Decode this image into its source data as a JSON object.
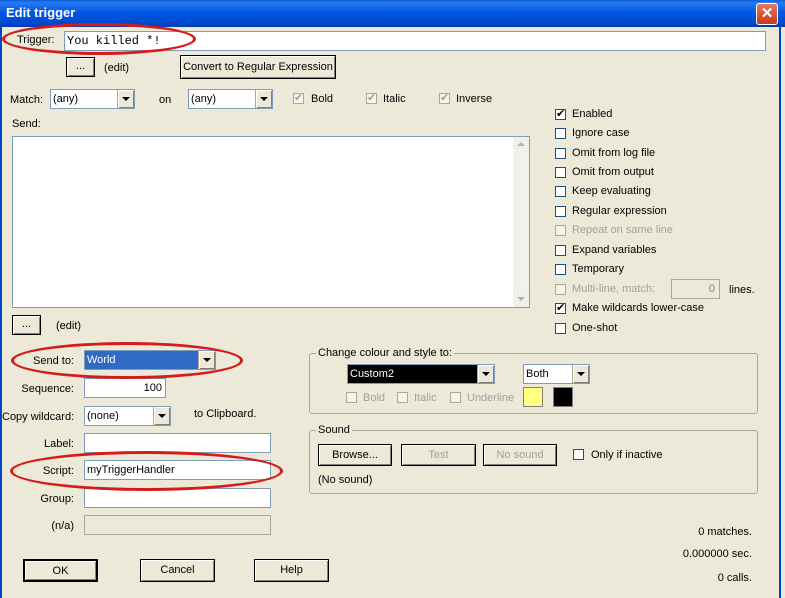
{
  "window": {
    "title": "Edit trigger",
    "close_glyph": "✕"
  },
  "trigger": {
    "label": "Trigger:",
    "value": "You killed *!",
    "edit_btn": "...",
    "edit_label": "(edit)",
    "convert_btn": "Convert to Regular Expression"
  },
  "match": {
    "label": "Match:",
    "fg_value": "(any)",
    "on_label": "on",
    "bg_value": "(any)",
    "bold": {
      "label": "Bold",
      "checked": true
    },
    "italic": {
      "label": "Italic",
      "checked": true
    },
    "inverse": {
      "label": "Inverse",
      "checked": true
    }
  },
  "send": {
    "label": "Send:",
    "value": "",
    "edit_btn": "...",
    "edit_label": "(edit)"
  },
  "options": [
    {
      "label": "Enabled",
      "checked": true,
      "enabled": true
    },
    {
      "label": "Ignore case",
      "checked": false,
      "enabled": true
    },
    {
      "label": "Omit from log file",
      "checked": false,
      "enabled": true
    },
    {
      "label": "Omit from output",
      "checked": false,
      "enabled": true
    },
    {
      "label": "Keep evaluating",
      "checked": false,
      "enabled": true
    },
    {
      "label": "Regular expression",
      "checked": false,
      "enabled": true
    },
    {
      "label": "Repeat on same line",
      "checked": false,
      "enabled": false
    },
    {
      "label": "Expand variables",
      "checked": false,
      "enabled": true
    },
    {
      "label": "Temporary",
      "checked": false,
      "enabled": true
    },
    {
      "label": "Multi-line, match:",
      "checked": false,
      "enabled": false
    },
    {
      "label": "Make wildcards lower-case",
      "checked": true,
      "enabled": true
    },
    {
      "label": "One-shot",
      "checked": false,
      "enabled": true
    }
  ],
  "multiline": {
    "lines_value": "0",
    "lines_label": "lines."
  },
  "send_to": {
    "label": "Send to:",
    "value": "World"
  },
  "sequence": {
    "label": "Sequence:",
    "value": "100"
  },
  "copy_wildcard": {
    "label": "Copy wildcard:",
    "value": "(none)",
    "suffix": "to Clipboard."
  },
  "label_field": {
    "label": "Label:",
    "value": ""
  },
  "script": {
    "label": "Script:",
    "value": "myTriggerHandler"
  },
  "group": {
    "label": "Group:",
    "value": ""
  },
  "na": {
    "label": "(n/a)",
    "value": ""
  },
  "colour": {
    "group_title": "Change colour and style to:",
    "colour_value": "Custom2",
    "both_value": "Both",
    "bold": "Bold",
    "italic": "Italic",
    "underline": "Underline",
    "swatch_fg": "#ffff80",
    "swatch_bg": "#000000"
  },
  "sound": {
    "group_title": "Sound",
    "browse": "Browse...",
    "test": "Test",
    "no_sound_btn": "No sound",
    "only_inactive": "Only if inactive",
    "status": "(No sound)"
  },
  "stats": {
    "matches": "0 matches.",
    "time": "0.000000 sec.",
    "calls": "0 calls."
  },
  "buttons": {
    "ok": "OK",
    "cancel": "Cancel",
    "help": "Help"
  },
  "annotation_color": "#d51c1c"
}
